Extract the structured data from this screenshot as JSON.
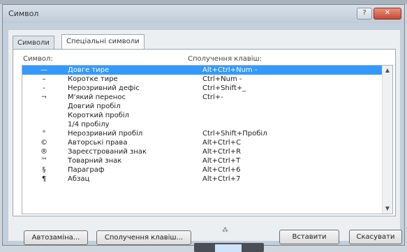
{
  "dialog": {
    "title": "Символ",
    "help_glyph": "?",
    "close_glyph": "✕"
  },
  "tabs": [
    {
      "label": "Символи",
      "active": false
    },
    {
      "label": "Спеціальні символи",
      "active": true
    }
  ],
  "columns": {
    "symbol": "Символ:",
    "shortcut": "Сполучення клавіш:"
  },
  "rows": [
    {
      "symbol": "—",
      "name": "Довге тире",
      "key": "Alt+Ctrl+Num -",
      "selected": true
    },
    {
      "symbol": "–",
      "name": "Коротке тире",
      "key": "Ctrl+Num -",
      "selected": false
    },
    {
      "symbol": "‑",
      "name": "Нерозривний дефіс",
      "key": "Ctrl+Shift+_",
      "selected": false
    },
    {
      "symbol": "¬",
      "name": "М'який перенос",
      "key": "Ctrl+-",
      "selected": false
    },
    {
      "symbol": "",
      "name": "Довгий пробіл",
      "key": "",
      "selected": false
    },
    {
      "symbol": "",
      "name": "Короткий пробіл",
      "key": "",
      "selected": false
    },
    {
      "symbol": "",
      "name": "1/4 пробілу",
      "key": "",
      "selected": false
    },
    {
      "symbol": "°",
      "name": "Нерозривний пробіл",
      "key": "Ctrl+Shift+Пробіл",
      "selected": false
    },
    {
      "symbol": "©",
      "name": "Авторські права",
      "key": "Alt+Ctrl+C",
      "selected": false
    },
    {
      "symbol": "®",
      "name": "Зареєстрований знак",
      "key": "Alt+Ctrl+R",
      "selected": false
    },
    {
      "symbol": "™",
      "name": "Товарний знак",
      "key": "Alt+Ctrl+T",
      "selected": false
    },
    {
      "symbol": "§",
      "name": "Параграф",
      "key": "Alt+Ctrl+6",
      "selected": false
    },
    {
      "symbol": "¶",
      "name": "Абзац",
      "key": "Alt+Ctrl+7",
      "selected": false
    }
  ],
  "buttons": {
    "autocorrect": "Автозаміна...",
    "shortcut": "Сполучення клавіш...",
    "insert": "Вставити",
    "cancel": "Скасувати"
  },
  "scroll": {
    "up": "▲",
    "down": "▼"
  },
  "colors": {
    "selection": "#3399ff",
    "close": "#c64a35"
  }
}
